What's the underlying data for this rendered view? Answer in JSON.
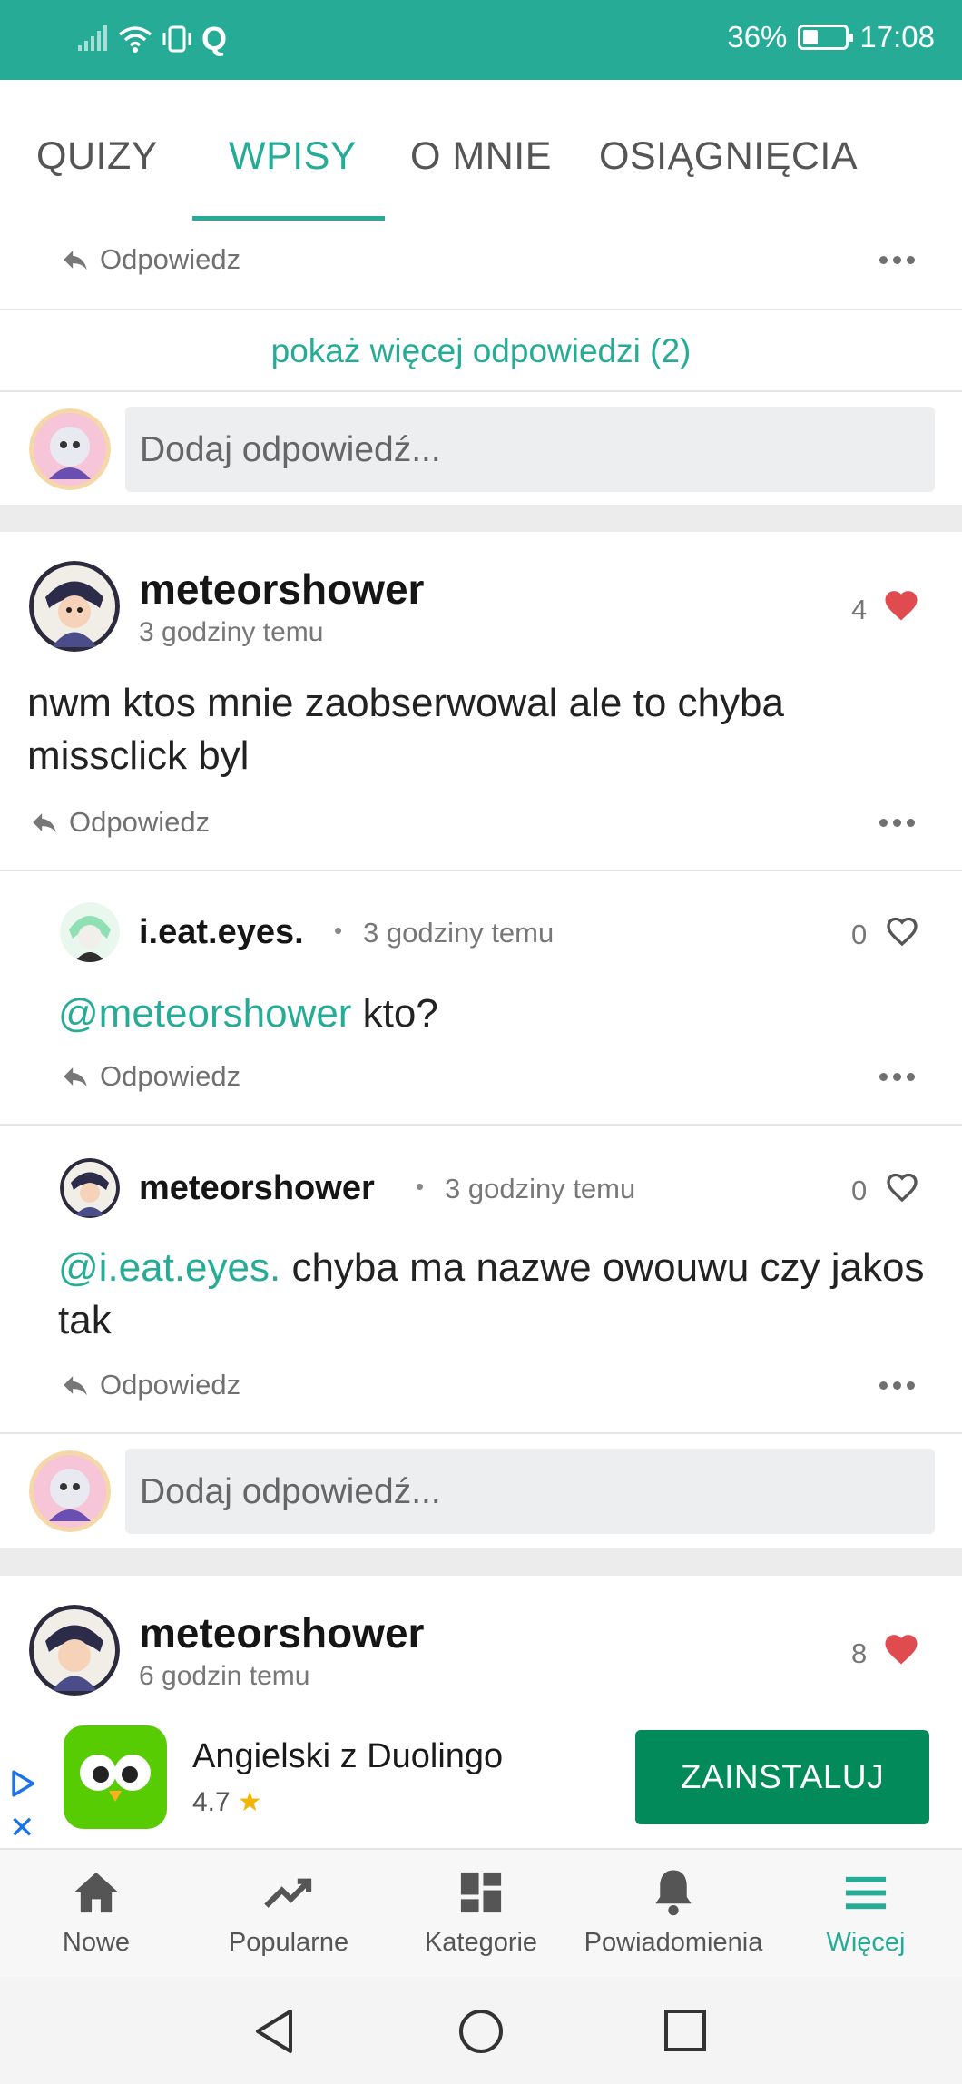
{
  "status_bar": {
    "battery": "36%",
    "time": "17:08",
    "battery_level": 0.36
  },
  "tabs": [
    {
      "label": "QUIZY"
    },
    {
      "label": "WPISY"
    },
    {
      "label": "O MNIE"
    },
    {
      "label": "OSIĄGNIĘCIA"
    }
  ],
  "active_tab": "WPISY",
  "top_reply": {
    "reply_label": "Odpowiedz"
  },
  "show_more": "pokaż więcej odpowiedzi (2)",
  "reply_input_1": {
    "placeholder": "Dodaj odpowiedź..."
  },
  "post": {
    "username": "meteorshower",
    "time": "3 godziny temu",
    "likes": "4",
    "text": "nwm ktos mnie zaobserwowal ale to chyba missclick byl",
    "reply_label": "Odpowiedz"
  },
  "comments": [
    {
      "username": "i.eat.eyes.",
      "time": "3 godziny temu",
      "likes": "0",
      "mention": "@meteorshower",
      "text": " kto?",
      "reply_label": "Odpowiedz"
    },
    {
      "username": "meteorshower",
      "time": "3 godziny temu",
      "likes": "0",
      "mention": "@i.eat.eyes.",
      "text": " chyba ma nazwe owouwu czy jakos tak",
      "reply_label": "Odpowiedz"
    }
  ],
  "reply_input_2": {
    "placeholder": "Dodaj odpowiedź..."
  },
  "post2": {
    "username": "meteorshower",
    "time": "6 godzin temu",
    "likes": "8"
  },
  "ad": {
    "title": "Angielski z Duolingo",
    "rating": "4.7",
    "button": "ZAINSTALUJ"
  },
  "bottom_nav": [
    {
      "label": "Nowe"
    },
    {
      "label": "Popularne"
    },
    {
      "label": "Kategorie"
    },
    {
      "label": "Powiadomienia"
    },
    {
      "label": "Więcej"
    }
  ],
  "colors": {
    "accent": "#26ac96",
    "heart": "#e04b50",
    "ad_button": "#028a5a"
  }
}
